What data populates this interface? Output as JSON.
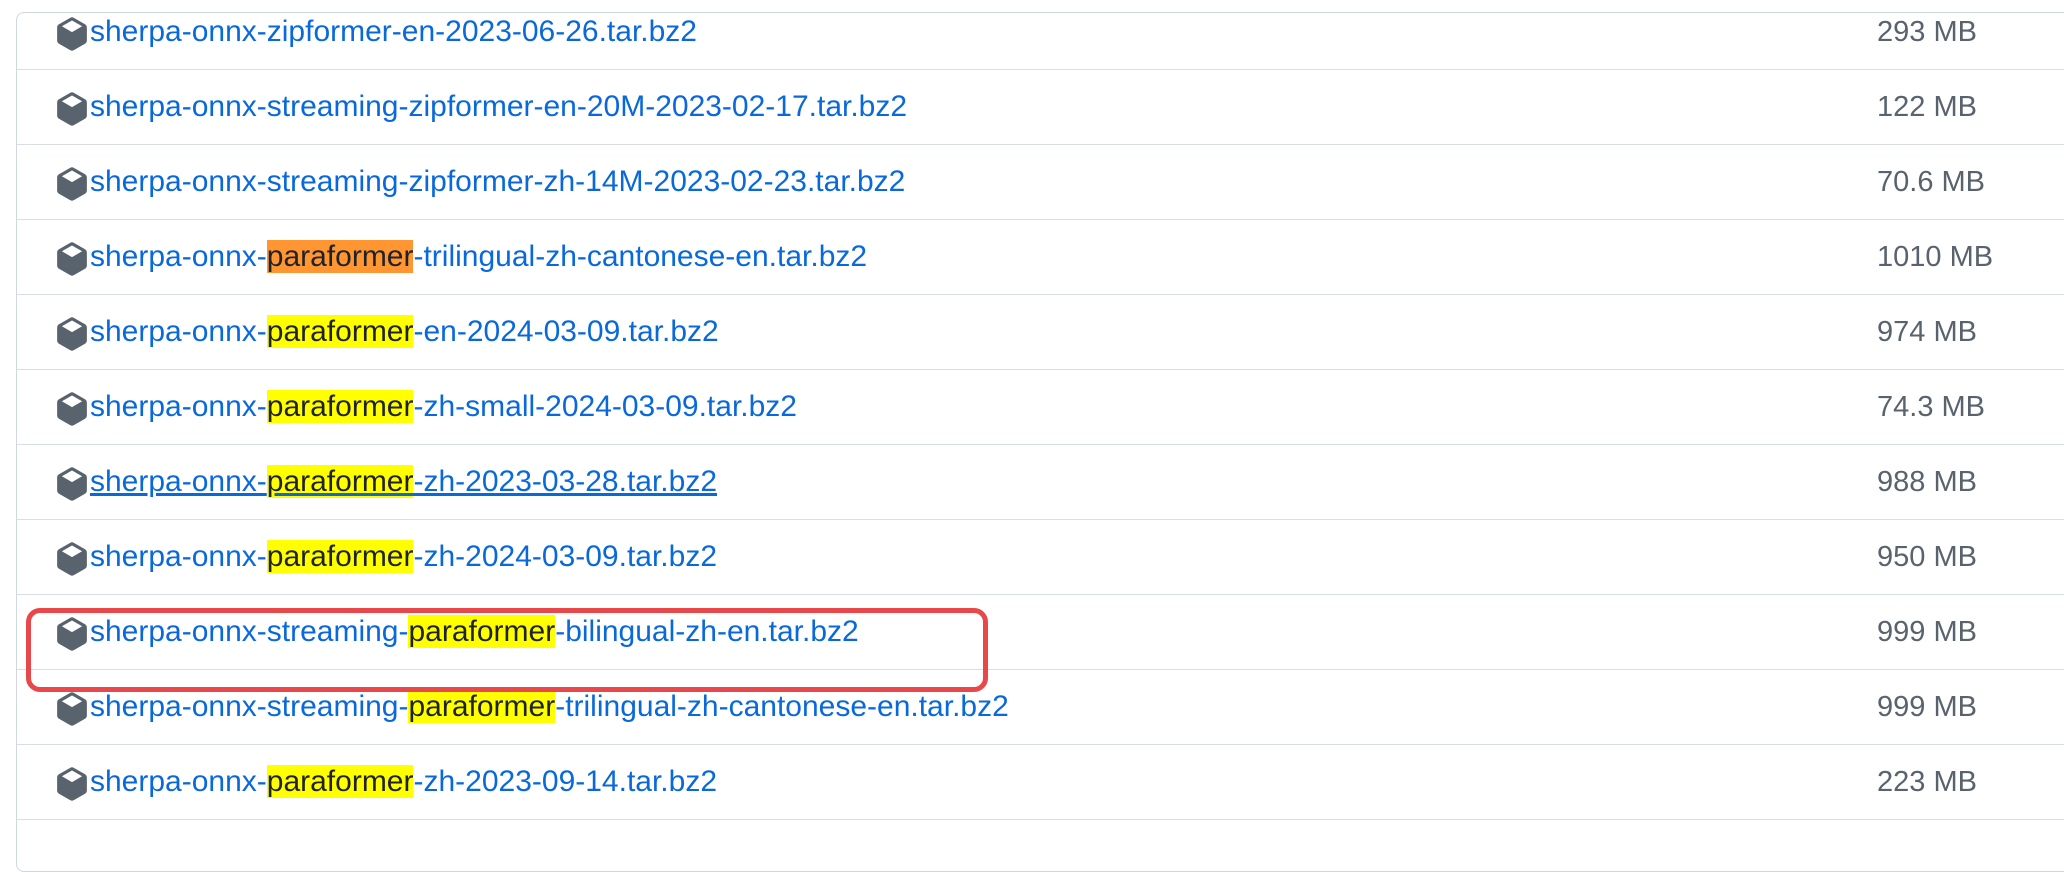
{
  "icons": {
    "package": "package-icon"
  },
  "colors": {
    "link": "#0969da",
    "highlight": "#ffff00",
    "current_match": "#ff9632",
    "annotation_box": "#e8484a"
  },
  "search_term": "paraformer",
  "assets": [
    {
      "name": "sherpa-onnx-zipformer-en-2023-06-26.tar.bz2",
      "prefix": "sherpa-onnx-zipformer-en-2023-06-26.tar.bz2",
      "match": "",
      "suffix": "",
      "size": "293 MB"
    },
    {
      "name": "sherpa-onnx-streaming-zipformer-en-20M-2023-02-17.tar.bz2",
      "prefix": "sherpa-onnx-streaming-zipformer-en-20M-2023-02-17.tar.bz2",
      "match": "",
      "suffix": "",
      "size": "122 MB"
    },
    {
      "name": "sherpa-onnx-streaming-zipformer-zh-14M-2023-02-23.tar.bz2",
      "prefix": "sherpa-onnx-streaming-zipformer-zh-14M-2023-02-23.tar.bz2",
      "match": "",
      "suffix": "",
      "size": "70.6 MB"
    },
    {
      "name": "sherpa-onnx-paraformer-trilingual-zh-cantonese-en.tar.bz2",
      "prefix": "sherpa-onnx-",
      "match": "paraformer",
      "suffix": "-trilingual-zh-cantonese-en.tar.bz2",
      "size": "1010 MB",
      "current_match": true
    },
    {
      "name": "sherpa-onnx-paraformer-en-2024-03-09.tar.bz2",
      "prefix": "sherpa-onnx-",
      "match": "paraformer",
      "suffix": "-en-2024-03-09.tar.bz2",
      "size": "974 MB"
    },
    {
      "name": "sherpa-onnx-paraformer-zh-small-2024-03-09.tar.bz2",
      "prefix": "sherpa-onnx-",
      "match": "paraformer",
      "suffix": "-zh-small-2024-03-09.tar.bz2",
      "size": "74.3 MB"
    },
    {
      "name": "sherpa-onnx-paraformer-zh-2023-03-28.tar.bz2",
      "prefix": "sherpa-onnx-",
      "match": "paraformer",
      "suffix": "-zh-2023-03-28.tar.bz2",
      "size": "988 MB",
      "hovered": true
    },
    {
      "name": "sherpa-onnx-paraformer-zh-2024-03-09.tar.bz2",
      "prefix": "sherpa-onnx-",
      "match": "paraformer",
      "suffix": "-zh-2024-03-09.tar.bz2",
      "size": "950 MB"
    },
    {
      "name": "sherpa-onnx-streaming-paraformer-bilingual-zh-en.tar.bz2",
      "prefix": "sherpa-onnx-streaming-",
      "match": "paraformer",
      "suffix": "-bilingual-zh-en.tar.bz2",
      "size": "999 MB",
      "annotated": true
    },
    {
      "name": "sherpa-onnx-streaming-paraformer-trilingual-zh-cantonese-en.tar.bz2",
      "prefix": "sherpa-onnx-streaming-",
      "match": "paraformer",
      "suffix": "-trilingual-zh-cantonese-en.tar.bz2",
      "size": "999 MB"
    },
    {
      "name": "sherpa-onnx-paraformer-zh-2023-09-14.tar.bz2",
      "prefix": "sherpa-onnx-",
      "match": "paraformer",
      "suffix": "-zh-2023-09-14.tar.bz2",
      "size": "223 MB"
    }
  ]
}
